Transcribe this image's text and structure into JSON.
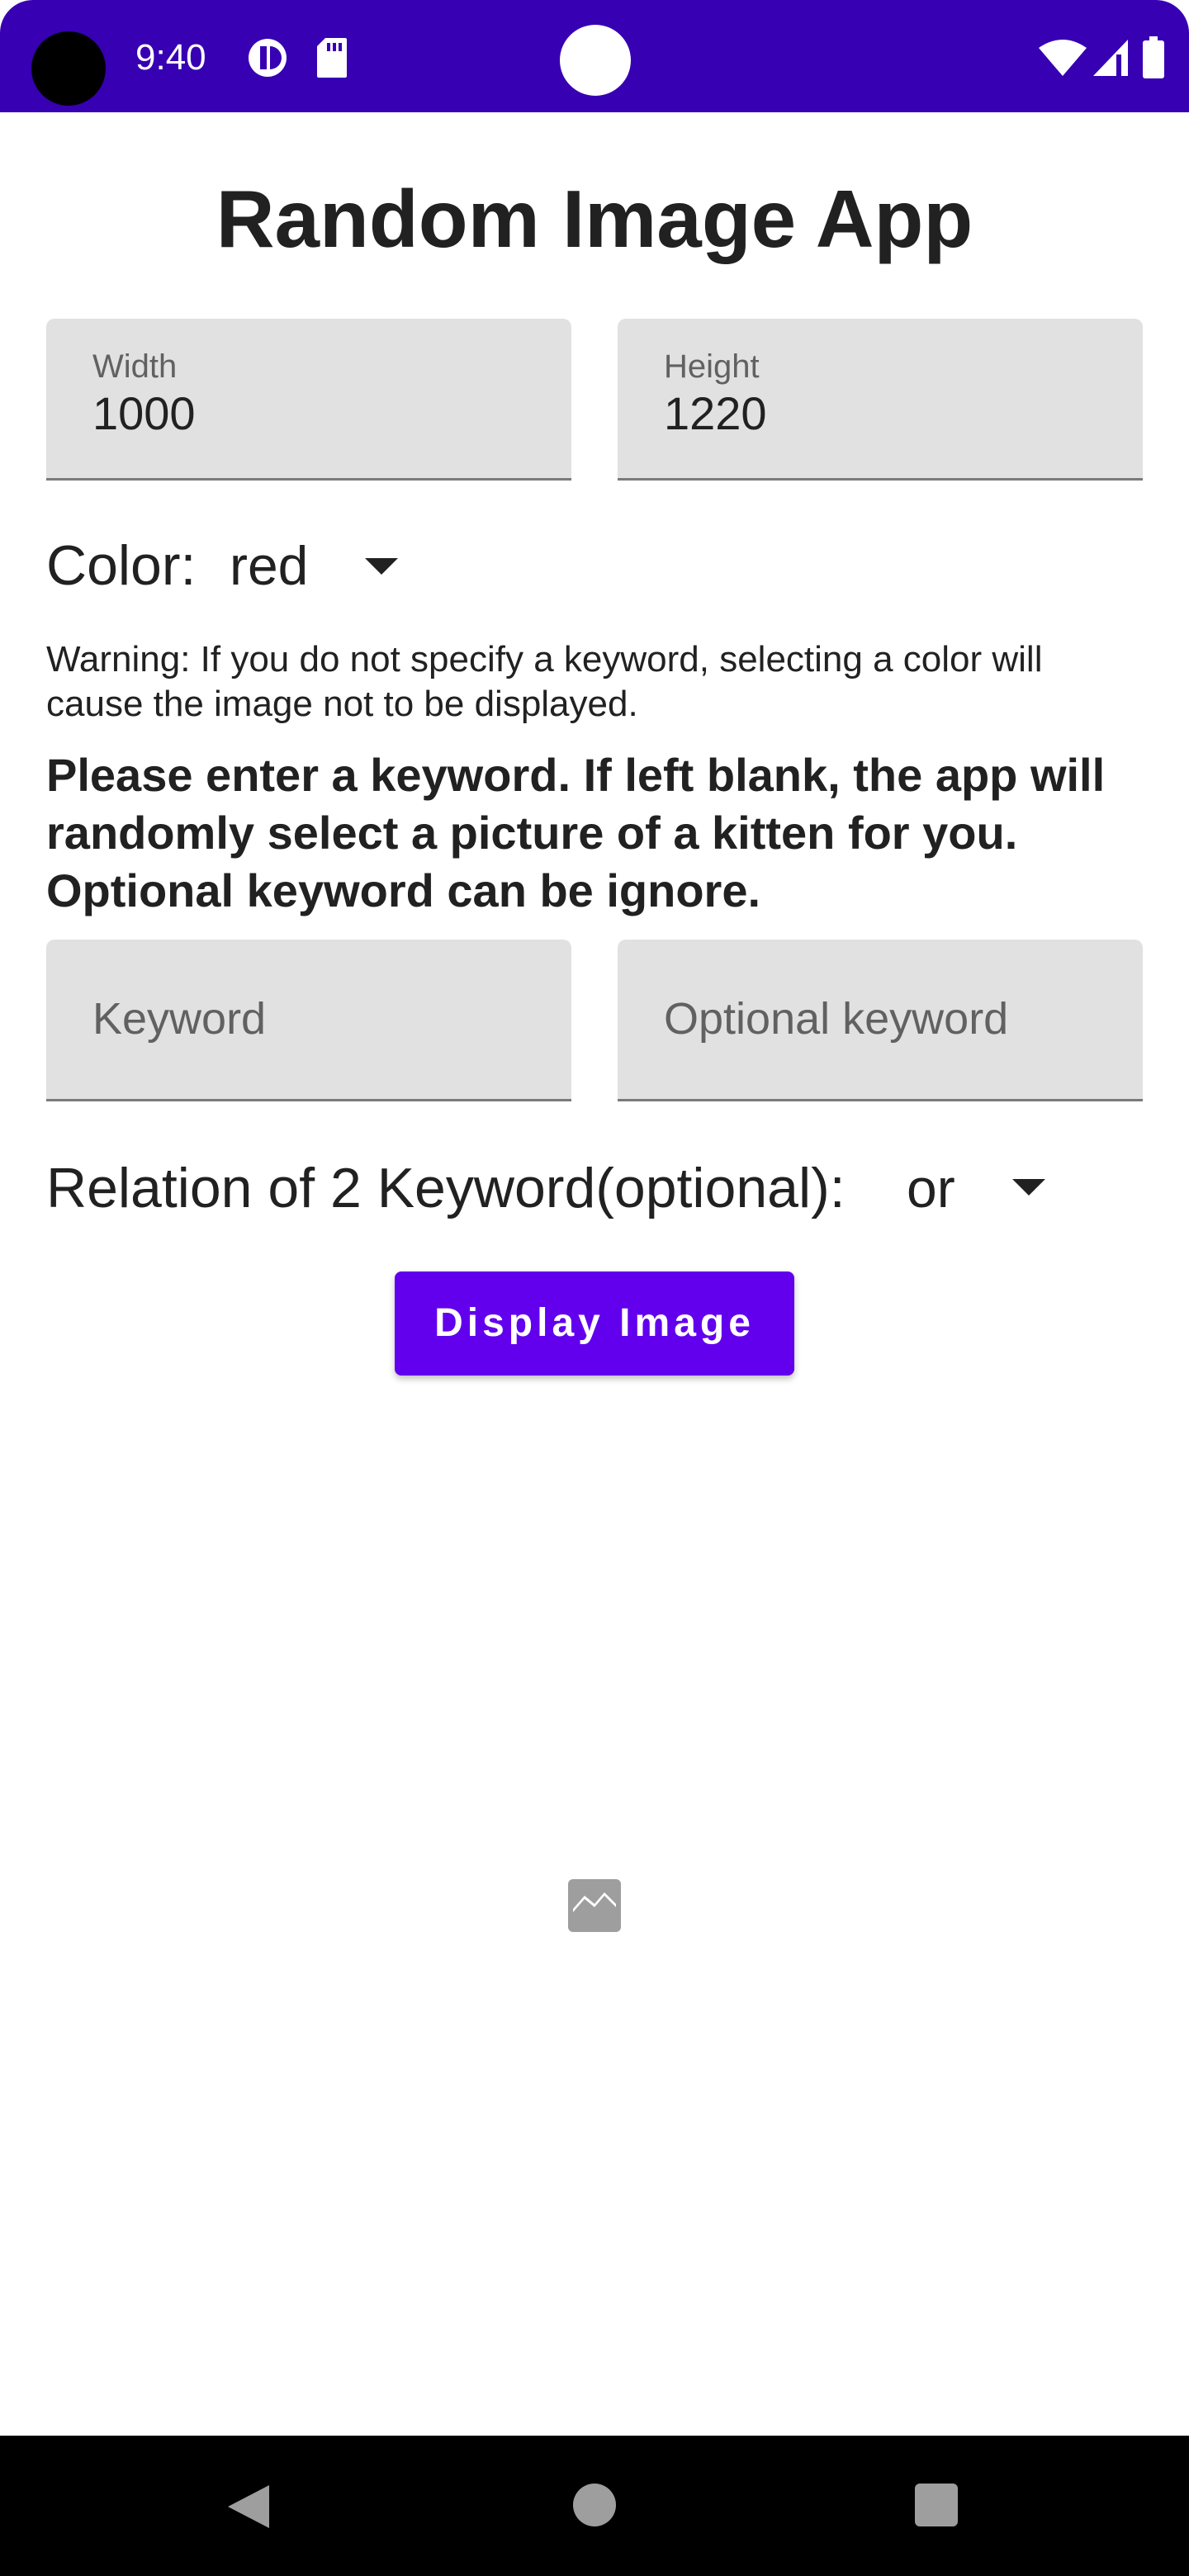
{
  "status_bar": {
    "time": "9:40",
    "icons": [
      "camera-hole",
      "alarm-icon",
      "sd-card-icon",
      "wifi-icon",
      "signal-icon",
      "battery-icon"
    ],
    "background": "#3700b3"
  },
  "app": {
    "title": "Random Image App"
  },
  "width_field": {
    "label": "Width",
    "value": "1000"
  },
  "height_field": {
    "label": "Height",
    "value": "1220"
  },
  "color_row": {
    "label": "Color:",
    "selected": "red"
  },
  "warning": "Warning: If you do not specify a keyword, selecting a color will cause the image not to be displayed.",
  "instruction": "Please enter a keyword. If left blank, the app will randomly select a picture of a kitten for you. Optional keyword can be ignore.",
  "keyword_field": {
    "placeholder": "Keyword",
    "value": ""
  },
  "optional_keyword_field": {
    "placeholder": "Optional keyword",
    "value": ""
  },
  "relation_row": {
    "label": "Relation of 2 Keyword(optional):",
    "selected": "or"
  },
  "display_button": {
    "label": "Display Image",
    "color": "#6200ee"
  },
  "image_view": {
    "icon": "broken-image-icon"
  },
  "nav_bar": {
    "icons": [
      "back-icon",
      "home-icon",
      "recents-icon"
    ]
  }
}
